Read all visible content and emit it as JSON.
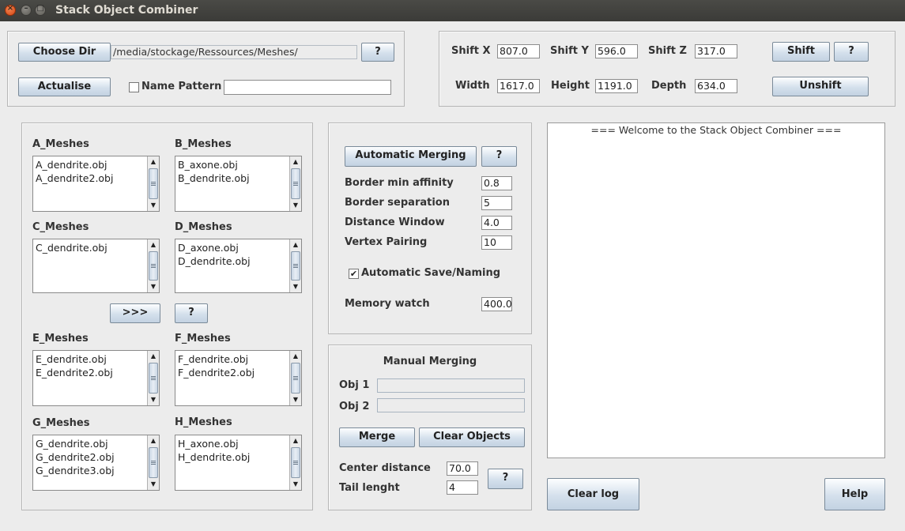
{
  "window": {
    "title": "Stack Object Combiner",
    "close_glyph": "×",
    "minimize_glyph": "–",
    "maximize_glyph": "□"
  },
  "directory": {
    "choose_label": "Choose Dir",
    "path": "/media/stockage/Ressources/Meshes/",
    "help_label": "?",
    "actualise_label": "Actualise",
    "name_pattern_label": "Name Pattern",
    "name_pattern_checked": false,
    "name_pattern_value": ""
  },
  "shift": {
    "shift_x_label": "Shift X",
    "shift_x": "807.0",
    "shift_y_label": "Shift Y",
    "shift_y": "596.0",
    "shift_z_label": "Shift Z",
    "shift_z": "317.0",
    "width_label": "Width",
    "width": "1617.0",
    "height_label": "Height",
    "height": "1191.0",
    "depth_label": "Depth",
    "depth": "634.0",
    "shift_button": "Shift",
    "help_label": "?",
    "unshift_button": "Unshift"
  },
  "meshes": {
    "a": {
      "label": "A_Meshes",
      "items": [
        "A_dendrite.obj",
        "A_dendrite2.obj"
      ]
    },
    "b": {
      "label": "B_Meshes",
      "items": [
        "B_axone.obj",
        "B_dendrite.obj"
      ]
    },
    "c": {
      "label": "C_Meshes",
      "items": [
        "C_dendrite.obj"
      ]
    },
    "d": {
      "label": "D_Meshes",
      "items": [
        "D_axone.obj",
        "D_dendrite.obj"
      ]
    },
    "e": {
      "label": "E_Meshes",
      "items": [
        "E_dendrite.obj",
        "E_dendrite2.obj"
      ]
    },
    "f": {
      "label": "F_Meshes",
      "items": [
        "F_dendrite.obj",
        "F_dendrite2.obj"
      ]
    },
    "g": {
      "label": "G_Meshes",
      "items": [
        "G_dendrite.obj",
        "G_dendrite2.obj",
        "G_dendrite3.obj"
      ]
    },
    "h": {
      "label": "H_Meshes",
      "items": [
        "H_axone.obj",
        "H_dendrite.obj"
      ]
    },
    "next_label": ">>>",
    "help_label": "?"
  },
  "automatic": {
    "button": "Automatic Merging",
    "help_label": "?",
    "border_affinity_label": "Border min affinity",
    "border_affinity": "0.8",
    "border_separation_label": "Border separation",
    "border_separation": "5",
    "distance_window_label": "Distance Window",
    "distance_window": "4.0",
    "vertex_pairing_label": "Vertex Pairing",
    "vertex_pairing": "10",
    "auto_save_label": "Automatic Save/Naming",
    "auto_save_checked": true,
    "check_glyph": "✔",
    "memory_watch_label": "Memory watch",
    "memory_watch": "400.0"
  },
  "manual": {
    "title": "Manual Merging",
    "obj1_label": "Obj 1",
    "obj1": "",
    "obj2_label": "Obj 2",
    "obj2": "",
    "merge_button": "Merge",
    "clear_button": "Clear Objects",
    "center_distance_label": "Center distance",
    "center_distance": "70.0",
    "tail_length_label": "Tail lenght",
    "tail_length": "4",
    "help_label": "?"
  },
  "log": {
    "text": "=== Welcome to the Stack Object Combiner ===",
    "clear_button": "Clear log",
    "help_button": "Help"
  },
  "scroll": {
    "up_glyph": "▲",
    "down_glyph": "▼"
  }
}
